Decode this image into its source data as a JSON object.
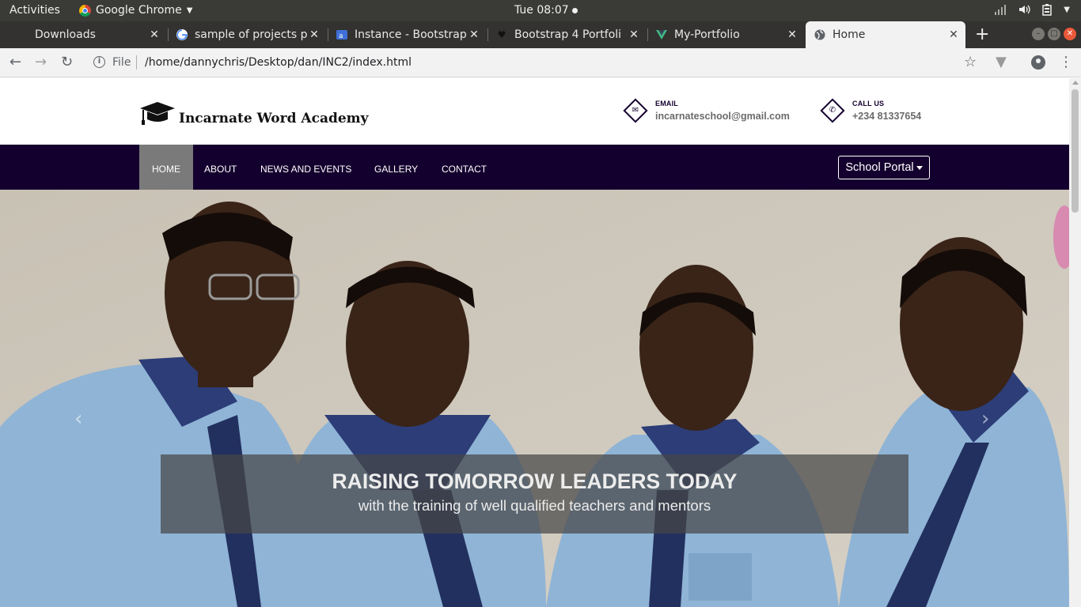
{
  "system_bar": {
    "activities": "Activities",
    "app_name": "Google Chrome",
    "clock": "Tue 08:07"
  },
  "browser": {
    "tabs": [
      {
        "title": "Downloads",
        "icon": "download-icon",
        "active": false
      },
      {
        "title": "sample of projects p",
        "icon": "google-icon",
        "active": false
      },
      {
        "title": "Instance - Bootstrap",
        "icon": "bootstrap-icon",
        "active": false
      },
      {
        "title": "Bootstrap 4 Portfoli",
        "icon": "heart-icon",
        "active": false
      },
      {
        "title": "My-Portfolio",
        "icon": "vue-icon",
        "active": false
      },
      {
        "title": "Home",
        "icon": "globe-icon",
        "active": true
      }
    ],
    "address": {
      "scheme_label": "File",
      "url": "/home/dannychris/Desktop/dan/INC2/index.html"
    }
  },
  "site": {
    "brand": "Incarnate Word Academy",
    "email": {
      "label": "EMAIL",
      "value": "incarnateschool@gmail.com"
    },
    "phone": {
      "label": "CALL US",
      "value": "+234 81337654"
    },
    "nav": [
      "HOME",
      "ABOUT",
      "NEWS AND EVENTS",
      "GALLERY",
      "CONTACT"
    ],
    "active_nav": "HOME",
    "portal_button": "School Portal",
    "hero": {
      "title": "RAISING TOMORROW LEADERS TODAY",
      "subtitle": "with the training of well qualified teachers and mentors"
    }
  },
  "colors": {
    "nav_bg": "#14002e",
    "nav_active": "#7a7a7a",
    "caption_bg": "rgba(70,70,70,0.72)"
  }
}
